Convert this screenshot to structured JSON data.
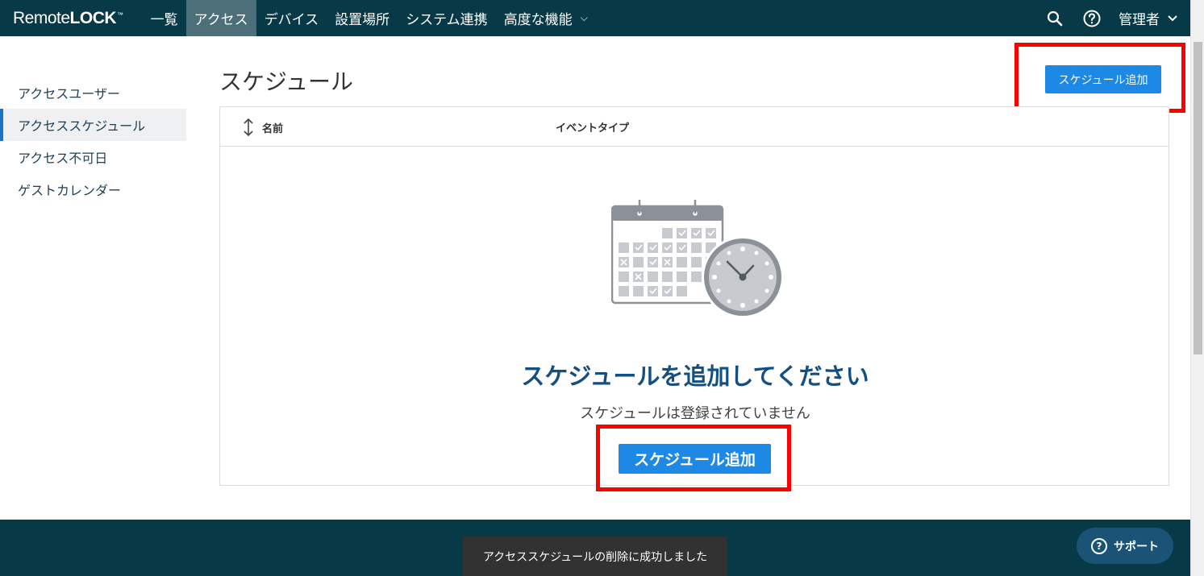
{
  "brand": {
    "name_part1": "Remote",
    "name_part2": "LOCK",
    "trademark": "™"
  },
  "nav": {
    "items": [
      {
        "label": "一覧"
      },
      {
        "label": "アクセス",
        "active": true
      },
      {
        "label": "デバイス"
      },
      {
        "label": "設置場所"
      },
      {
        "label": "システム連携"
      },
      {
        "label": "高度な機能"
      }
    ],
    "user_label": "管理者",
    "icons": [
      "search-icon",
      "help-icon",
      "chevron-down-icon"
    ]
  },
  "sidebar": {
    "items": [
      {
        "label": "アクセスユーザー"
      },
      {
        "label": "アクセススケジュール",
        "active": true
      },
      {
        "label": "アクセス不可日"
      },
      {
        "label": "ゲストカレンダー"
      }
    ]
  },
  "main": {
    "title": "スケジュール",
    "add_button_label": "スケジュール追加",
    "table": {
      "columns": [
        {
          "label": "名前",
          "sortable": true
        },
        {
          "label": "イベントタイプ"
        }
      ]
    },
    "empty_state": {
      "illustration": "calendar-clock-icon",
      "title": "スケジュールを追加してください",
      "subtitle": "スケジュールは登録されていません",
      "button_label": "スケジュール追加"
    }
  },
  "toast": {
    "message": "アクセススケジュールの削除に成功しました"
  },
  "support": {
    "label": "サポート",
    "icon": "?"
  },
  "colors": {
    "nav_bg": "#073946",
    "primary": "#1e88e5",
    "empty_title": "#135081",
    "highlight": "#ff0000"
  }
}
